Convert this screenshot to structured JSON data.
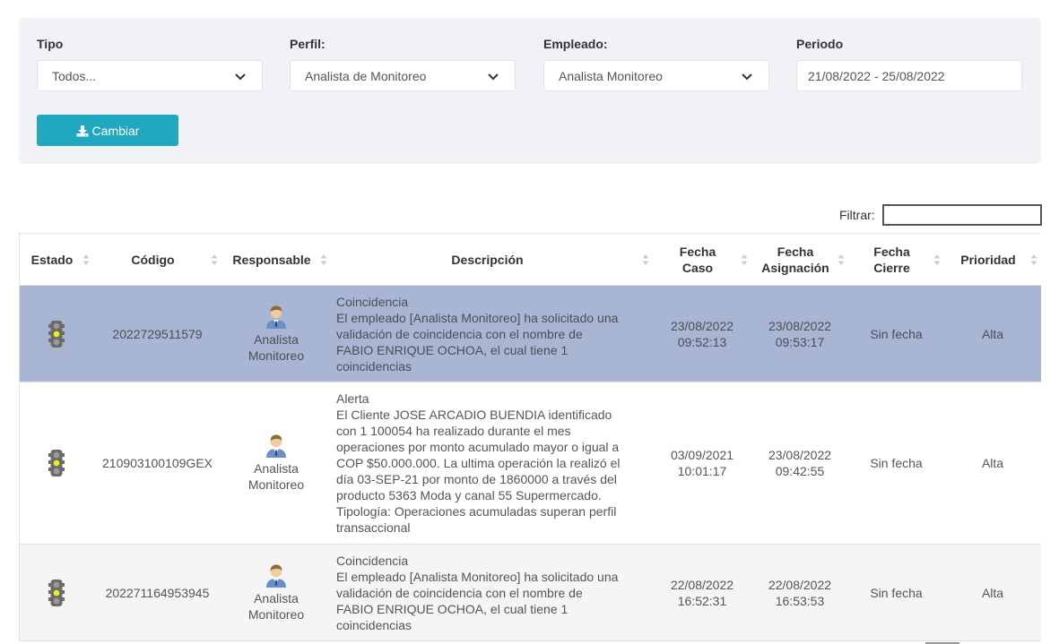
{
  "filters": {
    "tipo": {
      "label": "Tipo",
      "value": "Todos..."
    },
    "perfil": {
      "label": "Perfil:",
      "value": "Analista de Monitoreo"
    },
    "empleado": {
      "label": "Empleado:",
      "value": "Analista Monitoreo"
    },
    "periodo": {
      "label": "Periodo",
      "value": "21/08/2022 - 25/08/2022"
    },
    "change_button": "Cambiar"
  },
  "search": {
    "label": "Filtrar:",
    "value": ""
  },
  "table": {
    "columns": [
      {
        "line1": "Estado",
        "line2": ""
      },
      {
        "line1": "Código",
        "line2": ""
      },
      {
        "line1": "Responsable",
        "line2": ""
      },
      {
        "line1": "Descripción",
        "line2": ""
      },
      {
        "line1": "Fecha",
        "line2": "Caso"
      },
      {
        "line1": "Fecha",
        "line2": "Asignación"
      },
      {
        "line1": "Fecha",
        "line2": "Cierre"
      },
      {
        "line1": "Prioridad",
        "line2": ""
      }
    ],
    "rows": [
      {
        "estado_icon": "traffic-light-yellow-icon",
        "codigo": "2022729511579",
        "responsable_line1": "Analista",
        "responsable_line2": "Monitoreo",
        "descripcion": [
          "Coincidencia",
          "El empleado [Analista Monitoreo] ha solicitado una",
          "validación de coincidencia con el nombre de",
          "FABIO ENRIQUE OCHOA, el cual tiene 1",
          "coincidencias"
        ],
        "fecha_caso": [
          "23/08/2022",
          "09:52:13"
        ],
        "fecha_asignacion": [
          "23/08/2022",
          "09:53:17"
        ],
        "fecha_cierre": "Sin fecha",
        "prioridad": "Alta"
      },
      {
        "estado_icon": "traffic-light-yellow-icon",
        "codigo": "210903100109GEX",
        "responsable_line1": "Analista",
        "responsable_line2": "Monitoreo",
        "descripcion": [
          "Alerta",
          "El Cliente JOSE ARCADIO BUENDIA identificado",
          "con 1 100054 ha realizado durante el mes",
          "operaciones por monto acumulado mayor o igual a",
          "COP $50.000.000. La ultima operación la realizó el",
          "día 03-SEP-21 por monto de 1860000 a través del",
          "producto 5363 Moda y canal 55 Supermercado.",
          "Tipología: Operaciones acumuladas superan perfil",
          "transaccional"
        ],
        "fecha_caso": [
          "03/09/2021",
          "10:01:17"
        ],
        "fecha_asignacion": [
          "23/08/2022",
          "09:42:55"
        ],
        "fecha_cierre": "Sin fecha",
        "prioridad": "Alta"
      },
      {
        "estado_icon": "traffic-light-yellow-icon",
        "codigo": "202271164953945",
        "responsable_line1": "Analista",
        "responsable_line2": "Monitoreo",
        "descripcion": [
          "Coincidencia",
          "El empleado [Analista Monitoreo] ha solicitado una",
          "validación de coincidencia con el nombre de",
          "FABIO ENRIQUE OCHOA, el cual tiene 1",
          "coincidencias"
        ],
        "fecha_caso": [
          "22/08/2022",
          "16:52:31"
        ],
        "fecha_asignacion": [
          "22/08/2022",
          "16:53:53"
        ],
        "fecha_cierre": "Sin fecha",
        "prioridad": "Alta"
      }
    ]
  },
  "colors": {
    "accent_button": "#1fa8bf",
    "selected_row": "#a8b6d3",
    "panel_bg": "#f0f2f6"
  }
}
